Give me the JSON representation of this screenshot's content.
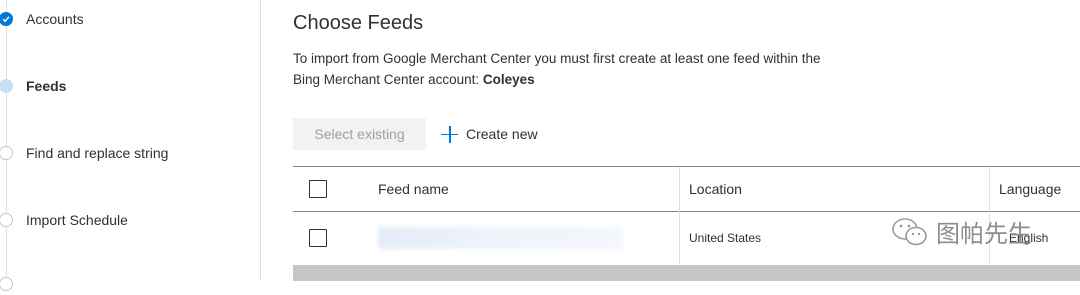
{
  "stepper": {
    "steps": [
      {
        "label": "Accounts",
        "state": "done"
      },
      {
        "label": "Feeds",
        "state": "current"
      },
      {
        "label": "Find and replace string",
        "state": "future"
      },
      {
        "label": "Import Schedule",
        "state": "future"
      }
    ]
  },
  "main": {
    "title": "Choose Feeds",
    "description_line1": "To import from Google Merchant Center you must first create at least one feed within the",
    "description_line2": "Bing Merchant Center account:",
    "account_name": "Coleyes",
    "select_existing_label": "Select existing",
    "create_new_label": "Create new"
  },
  "table": {
    "columns": [
      "Feed name",
      "Location",
      "Language"
    ],
    "rows": [
      {
        "feed_name": "",
        "location": "United States",
        "language": "English"
      }
    ]
  },
  "watermark": {
    "text": "图帕先生",
    "icon": "wechat-icon"
  },
  "colors": {
    "accent": "#0078d4",
    "current_step": "#c7e0f4",
    "disabled_bg": "#f3f2f1"
  }
}
